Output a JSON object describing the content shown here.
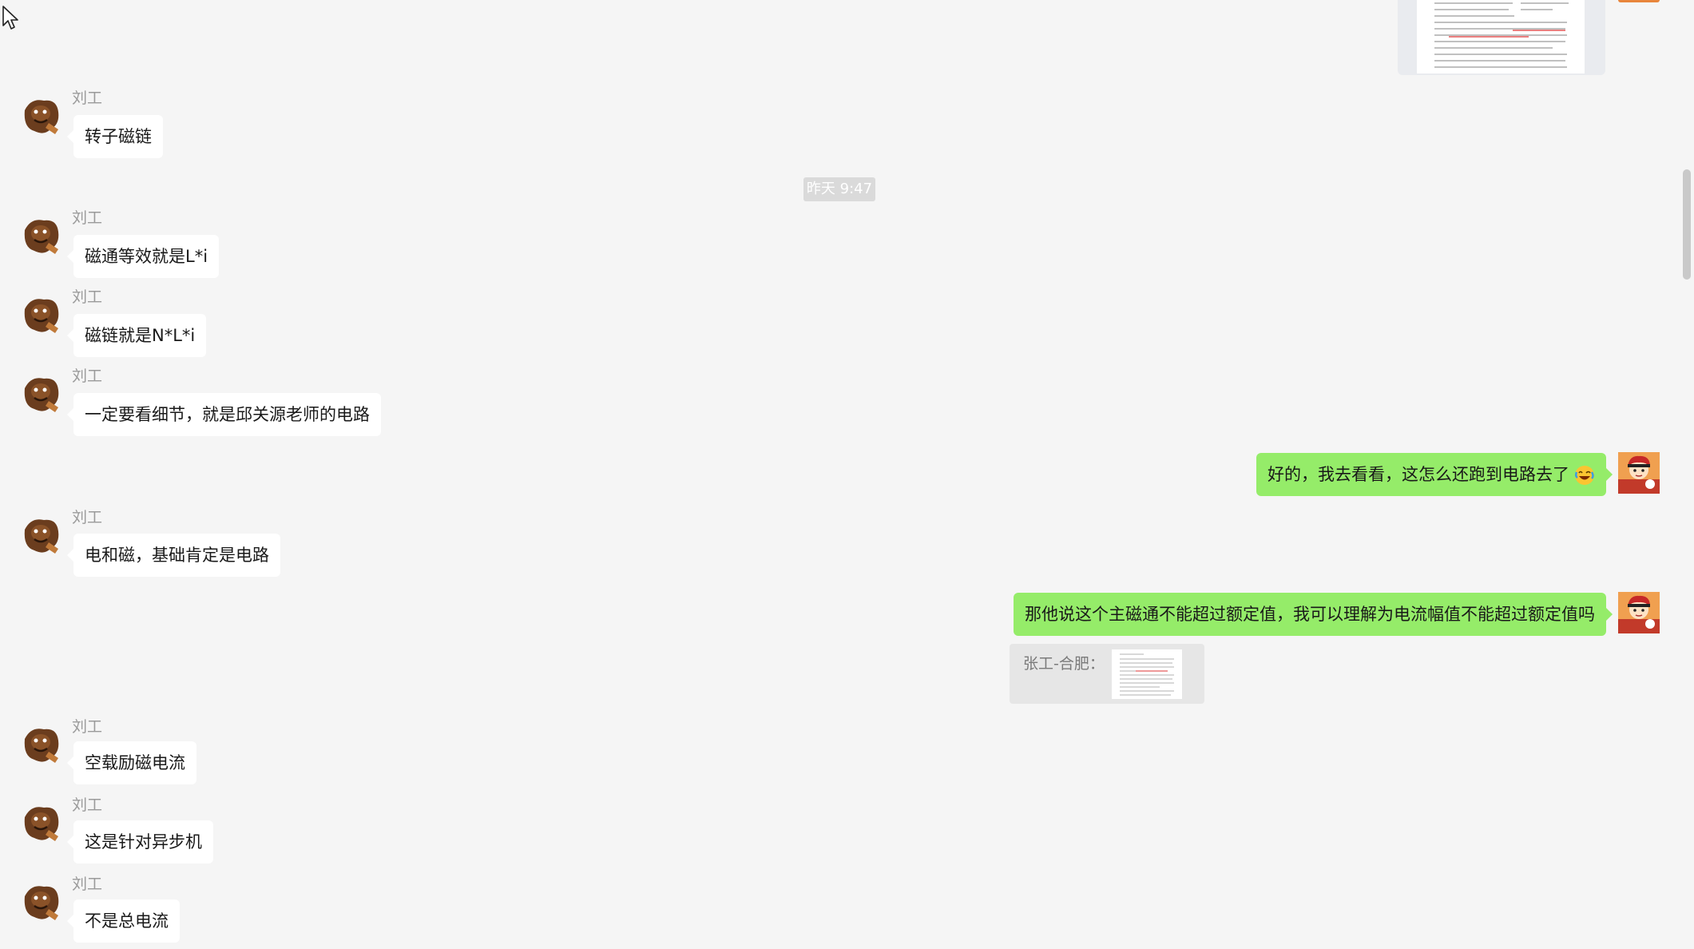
{
  "timestamp": "昨天 9:47",
  "messages": [
    {
      "sender": "刘工",
      "text": "转子磁链"
    },
    {
      "sender": "刘工",
      "text": "磁通等效就是L*i"
    },
    {
      "sender": "刘工",
      "text": "磁链就是N*L*i"
    },
    {
      "sender": "刘工",
      "text": "一定要看细节，就是邱关源老师的电路"
    },
    {
      "text": "好的，我去看看，这怎么还跑到电路去了",
      "emoji": "laughing-crying-emoji"
    },
    {
      "sender": "刘工",
      "text": "电和磁，基础肯定是电路"
    },
    {
      "text": "那他说这个主磁通不能超过额定值，我可以理解为电流幅值不能超过额定值吗"
    },
    {
      "sender": "刘工",
      "text": "空载励磁电流"
    },
    {
      "sender": "刘工",
      "text": "这是针对异步机"
    },
    {
      "sender": "刘工",
      "text": "不是总电流"
    }
  ],
  "quote": {
    "label": "张工-合肥："
  },
  "colors": {
    "background": "#f5f5f5",
    "incoming_bubble": "#ffffff",
    "outgoing_bubble": "#95ec69"
  }
}
